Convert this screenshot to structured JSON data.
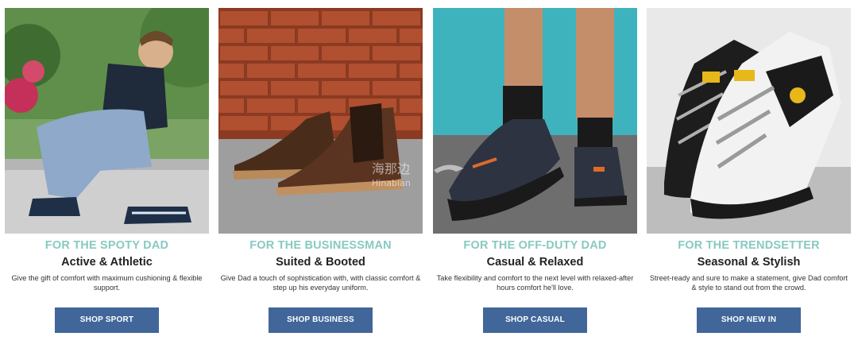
{
  "theme": {
    "kicker_color": "#88c9c2",
    "button_color": "#41669a"
  },
  "cards": [
    {
      "image_alt": "man-crouching-tying-athletic-sneaker",
      "kicker": "FOR THE SPOTY DAD",
      "title": "Active & Athletic",
      "description": "Give the gift of comfort with maximum cushioning & flexible support.",
      "button": "SHOP SPORT"
    },
    {
      "image_alt": "brown-leather-chelsea-boots-on-pavement",
      "kicker": "FOR THE BUSINESSMAN",
      "title": "Suited & Booted",
      "description": "Give Dad a touch of sophistication with, with classic comfort & step up his everyday uniform.",
      "button": "SHOP BUSINESS"
    },
    {
      "image_alt": "legs-walking-in-casual-sneakers",
      "kicker": "FOR THE OFF-DUTY DAD",
      "title": "Casual & Relaxed",
      "description": "Take flexibility and comfort to the next level with relaxed-after hours comfort he'll love.",
      "button": "SHOP CASUAL"
    },
    {
      "image_alt": "chunky-black-white-yellow-sneakers",
      "kicker": "FOR THE TRENDSETTER",
      "title": "Seasonal & Stylish",
      "description": "Street-ready and sure to make a statement, give Dad comfort & style to stand out from the crowd.",
      "button": "SHOP NEW IN"
    }
  ],
  "watermark": {
    "text_cn": "海那边",
    "text_en": "Hinabian"
  }
}
